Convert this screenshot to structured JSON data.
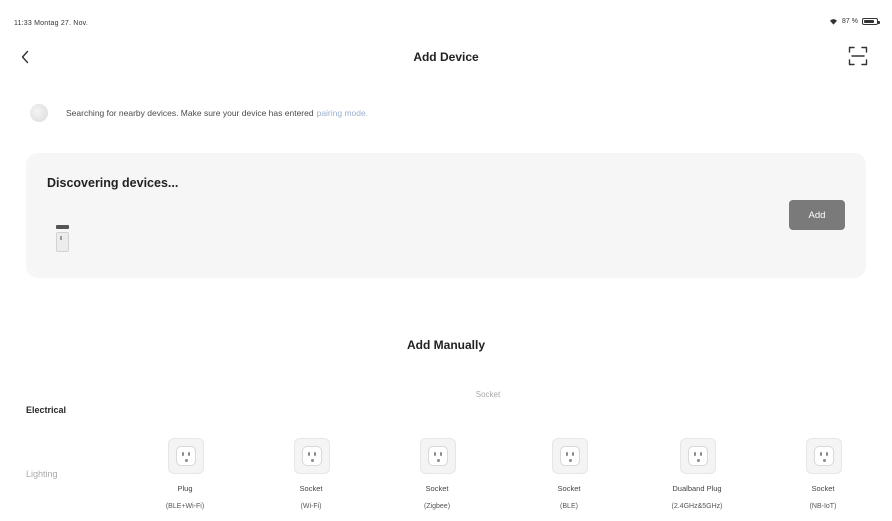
{
  "status_bar": {
    "time_date": "11:33  Montag 27. Nov.",
    "battery_text": "87 %",
    "battery_level": 0.87,
    "wifi_icon": "wifi-icon",
    "battery_icon": "battery-icon"
  },
  "nav": {
    "title": "Add Device",
    "back_icon": "chevron-left-icon",
    "scan_icon": "scan-icon"
  },
  "search_hint": {
    "text": "Searching for nearby devices. Make sure your device has entered",
    "link": "pairing mode."
  },
  "discovery": {
    "title": "Discovering devices...",
    "add_label": "Add"
  },
  "manual": {
    "title": "Add Manually",
    "categories": [
      {
        "label": "Electrical",
        "active": true
      },
      {
        "label": "Lighting",
        "active": false
      }
    ],
    "section_label": "Socket",
    "devices": [
      {
        "name": "Plug",
        "sub": "(BLE+Wi-Fi)"
      },
      {
        "name": "Socket",
        "sub": "(Wi-Fi)"
      },
      {
        "name": "Socket",
        "sub": "(Zigbee)"
      },
      {
        "name": "Socket",
        "sub": "(BLE)"
      },
      {
        "name": "Dualband Plug",
        "sub": "(2.4GHz&5GHz)"
      },
      {
        "name": "Socket",
        "sub": "(NB-IoT)"
      }
    ]
  },
  "colors": {
    "accent_link": "#9ab0cf",
    "add_button": "#7a7a7a",
    "card_background": "#f6f6f6"
  }
}
